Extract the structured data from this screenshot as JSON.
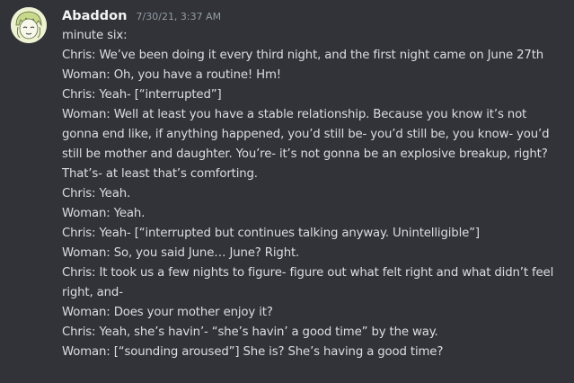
{
  "message": {
    "author": "Abaddon",
    "timestamp": "7/30/21, 3:37 AM",
    "avatar_icon": "cartoon-character-avatar",
    "lines": [
      "minute six:",
      "Chris: We’ve been doing it every third night, and the first night came on June 27th",
      "Woman: Oh, you have a routine! Hm!",
      "Chris: Yeah- [“interrupted”]",
      "Woman: Well at least you have a stable relationship. Because you know it’s not gonna end like, if anything happened, you’d still be- you’d still be, you know- you’d still be mother and daughter. You’re- it’s not gonna be an explosive breakup, right? That’s- at least that’s comforting.",
      "Chris: Yeah.",
      "Woman: Yeah.",
      "Chris: Yeah- [“interrupted but continues talking anyway. Unintelligible”]",
      "Woman: So, you said June… June? Right.",
      "Chris: It took us a few nights to figure- figure out what felt right and what didn’t feel right, and-",
      "Woman: Does your mother enjoy it?",
      "Chris: Yeah, she’s havin’- “she’s havin’ a good time” by the way.",
      "Woman: [“sounding aroused”] She is? She’s having a good time?"
    ]
  },
  "colors": {
    "background": "#313338",
    "text": "#dbdee1",
    "username": "#f2f3f5",
    "timestamp": "#949ba4"
  }
}
